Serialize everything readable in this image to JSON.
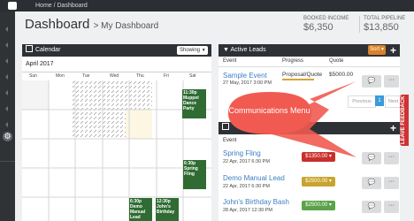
{
  "topbar": {
    "breadcrumb": "Home / Dashboard"
  },
  "page": {
    "title": "Dashboard",
    "subtitle": "> My Dashboard"
  },
  "stats": {
    "booked_label": "BOOKED INCOME",
    "booked_value": "$6,350",
    "pipeline_label": "TOTAL PIPELINE",
    "pipeline_value": "$13,850"
  },
  "calendar": {
    "title": "Calendar",
    "showing_label": "Showing",
    "month": "April 2017",
    "days": [
      "Sun",
      "Mon",
      "Tue",
      "Wed",
      "Thu",
      "Fri",
      "Sat"
    ],
    "events": [
      {
        "time": "11:30p",
        "title": "Muppet Dance Party"
      },
      {
        "time": "6:30p",
        "title": "Spring Fling"
      },
      {
        "time": "6:30p",
        "title": "Demo Manual Lead"
      },
      {
        "time": "12:30p",
        "title": "John's Birthday"
      }
    ]
  },
  "active_leads": {
    "title": "Active Leads",
    "sort_label": "Sort",
    "columns": [
      "Event",
      "Progress",
      "Quote"
    ],
    "sample": {
      "name": "Sample Event",
      "date": "27 May, 2017 3:00 PM",
      "progress": "Proposal/Quote",
      "quote": "$5000.00"
    },
    "pagination": {
      "previous": "Previous",
      "page": "1",
      "next": "Next"
    }
  },
  "booked": {
    "column": "Event",
    "rows": [
      {
        "name": "Spring Fling",
        "date": "22 Apr, 2017 6:30 PM",
        "amount": "$1350.00",
        "color": "#c9302c"
      },
      {
        "name": "Demo Manual Lead",
        "date": "22 Apr, 2017 6:30 PM",
        "amount": "$2500.00",
        "color": "#c8a42f"
      },
      {
        "name": "John's Birthday Bash",
        "date": "28 Apr, 2017 12:30 PM",
        "amount": "$2500.00",
        "color": "#5ba34a"
      }
    ]
  },
  "callout": {
    "text": "Communications Menu"
  },
  "feedback": {
    "label": "LEAVE FEEDBACK"
  },
  "colors": {
    "accent": "#d9822b",
    "dark": "#2e3236",
    "callout": "#f15a50"
  }
}
